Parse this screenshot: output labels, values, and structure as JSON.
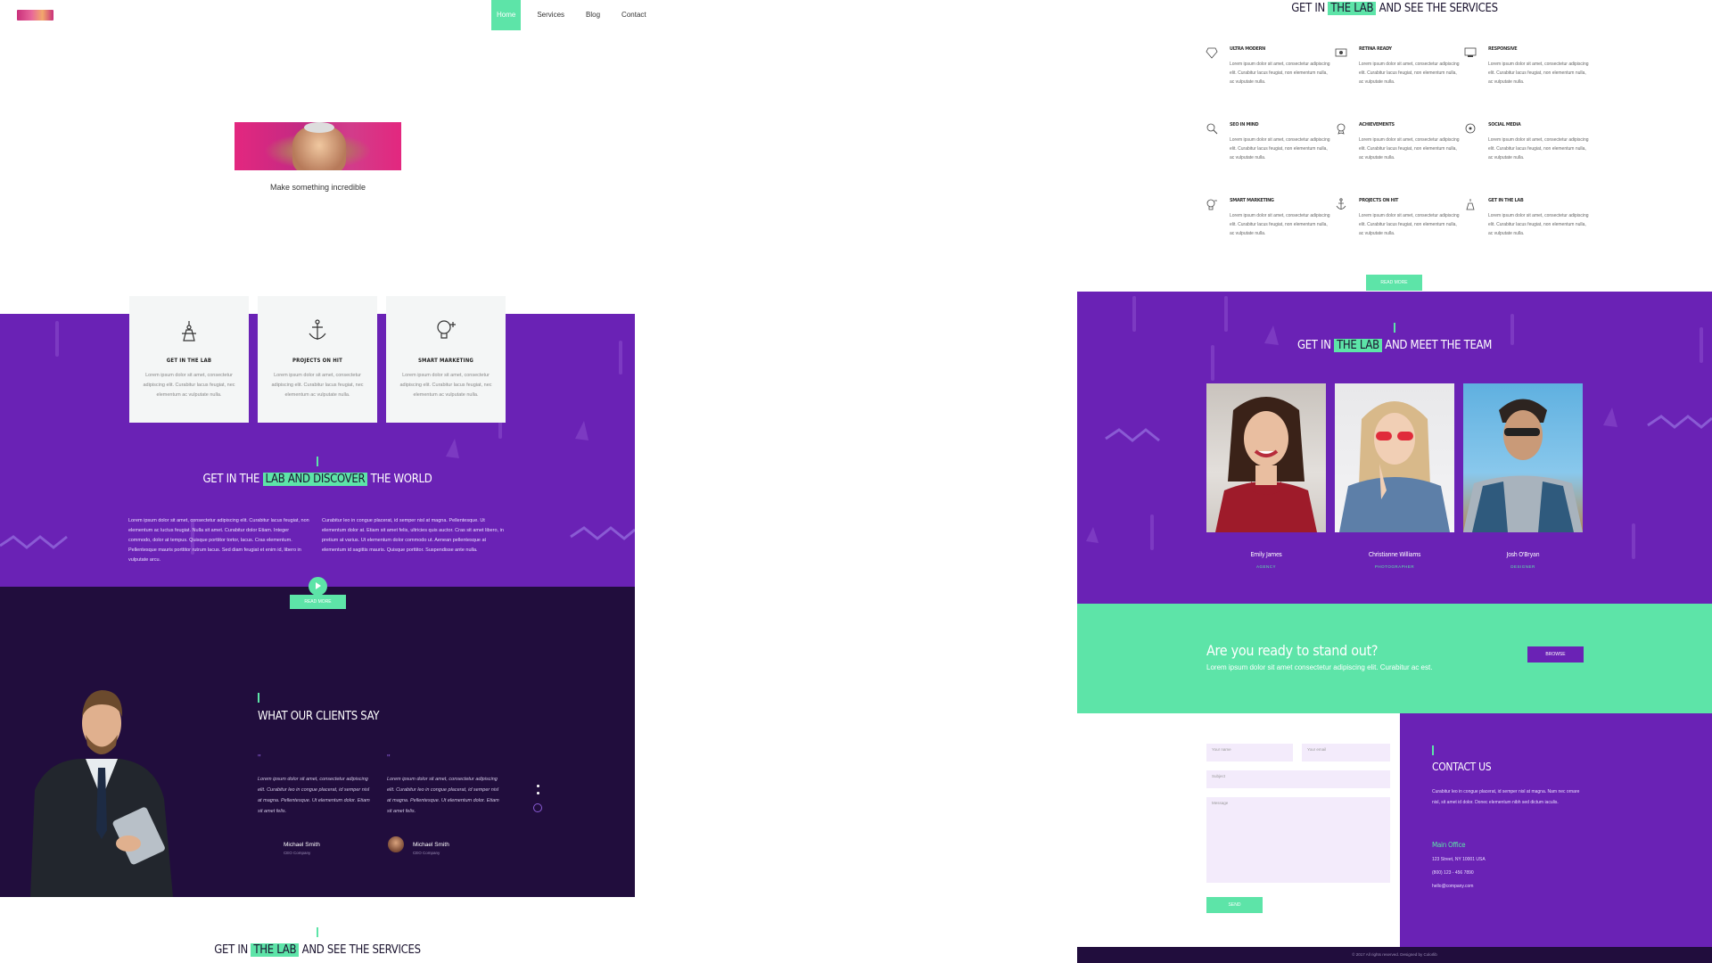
{
  "nav": {
    "items": [
      "Home",
      "Services",
      "Blog",
      "Contact"
    ],
    "active": "Home"
  },
  "hero": {
    "caption": "Make something incredible"
  },
  "features": [
    {
      "icon": "lab-icon",
      "title": "GET IN THE LAB",
      "text": "Lorem ipsum dolor sit amet, consectetur adipiscing elit. Curabitur lacus feugiat, nec elementum ac vulputate nulla."
    },
    {
      "icon": "anchor-icon",
      "title": "PROJECTS ON HIT",
      "text": "Lorem ipsum dolor sit amet, consectetur adipiscing elit. Curabitur lacus feugiat, nec elementum ac vulputate nulla."
    },
    {
      "icon": "lightbulb-gear-icon",
      "title": "SMART MARKETING",
      "text": "Lorem ipsum dolor sit amet, consectetur adipiscing elit. Curabitur lacus feugiat, nec elementum ac vulputate nulla."
    }
  ],
  "discover": {
    "title_pre": "GET IN THE ",
    "title_hl": "LAB AND DISCOVER",
    "title_post": " THE WORLD",
    "col1": "Lorem ipsum dolor sit amet, consectetur adipiscing elit. Curabitur lacus feugiat, non elementum ac luctus feugiat. Nulla sit amet. Curabitur dolor Etiam. Integer commodo, dolor at tempus. Quisque porttitor tortor, lacus. Cras elementum. Pellentesque mauris porttitor rutrum lacus. Sed diam feugiat et enim id, libero in vulputate arcu.",
    "col2": "Curabitur leo in congue placerat, id semper nisl at magna. Pellentesque. Ut elementum dolor at. Etiam sit amet felis, ultricies quis auctor. Cras sit amet libero, in pretium at varius. Ut elementum dolor commodo ut. Aenean pellentesque at elementum id sagittis mauris. Quisque porttitor. Suspendisse ante nulla.",
    "button": "READ MORE"
  },
  "clients": {
    "title": "WHAT OUR CLIENTS SAY",
    "quote1": "Lorem ipsum dolor sit amet, consectetur adipiscing elit. Curabitur leo in congue placerat, id semper nisl at magna. Pellentesque. Ut elementum dolor. Etiam sit amet felis.",
    "quote2": "Lorem ipsum dolor sit amet, consectetur adipiscing elit. Curabitur leo in congue placerat, id semper nisl at magna. Pellentesque. Ut elementum dolor. Etiam sit amet felis.",
    "name1": "Michael Smith",
    "role1": "CEO Company",
    "name2": "Michael Smith",
    "role2": "CEO Company"
  },
  "services_left": {
    "title_pre": "GET IN ",
    "title_hl": "THE LAB",
    "title_post": " AND SEE THE SERVICES"
  },
  "services": {
    "title_pre": "GET IN ",
    "title_hl": "THE LAB",
    "title_post": " AND SEE THE SERVICES",
    "items": [
      {
        "icon": "gem-icon",
        "title": "ULTRA MODERN",
        "text": "Lorem ipsum dolor sit amet, consectetur adipiscing elit. Curabitur lacus feugiat, non elementum nulla, ac vulputate nulla."
      },
      {
        "icon": "retina-icon",
        "title": "RETINA READY",
        "text": "Lorem ipsum dolor sit amet, consectetur adipiscing elit. Curabitur lacus feugiat, non elementum nulla, ac vulputate nulla."
      },
      {
        "icon": "responsive-icon",
        "title": "RESPONSIVE",
        "text": "Lorem ipsum dolor sit amet, consectetur adipiscing elit. Curabitur lacus feugiat, non elementum nulla, ac vulputate nulla."
      },
      {
        "icon": "magnifier-icon",
        "title": "SEO IN MIND",
        "text": "Lorem ipsum dolor sit amet, consectetur adipiscing elit. Curabitur lacus feugiat, non elementum nulla, ac vulputate nulla."
      },
      {
        "icon": "achievement-icon",
        "title": "ACHIEVEMENTS",
        "text": "Lorem ipsum dolor sit amet, consectetur adipiscing elit. Curabitur lacus feugiat, non elementum nulla, ac vulputate nulla."
      },
      {
        "icon": "social-icon",
        "title": "SOCIAL MEDIA",
        "text": "Lorem ipsum dolor sit amet, consectetur adipiscing elit. Curabitur lacus feugiat, non elementum nulla, ac vulputate nulla."
      },
      {
        "icon": "lightbulb-gear-icon",
        "title": "SMART MARKETING",
        "text": "Lorem ipsum dolor sit amet, consectetur adipiscing elit. Curabitur lacus feugiat, non elementum nulla, ac vulputate nulla."
      },
      {
        "icon": "anchor-icon",
        "title": "PROJECTS ON HIT",
        "text": "Lorem ipsum dolor sit amet, consectetur adipiscing elit. Curabitur lacus feugiat, non elementum nulla, ac vulputate nulla."
      },
      {
        "icon": "lab-icon",
        "title": "GET IN THE LAB",
        "text": "Lorem ipsum dolor sit amet, consectetur adipiscing elit. Curabitur lacus feugiat, non elementum nulla, ac vulputate nulla."
      }
    ],
    "button": "READ MORE"
  },
  "team": {
    "title_pre": "GET IN ",
    "title_hl": "THE LAB",
    "title_post": " AND MEET THE TEAM",
    "members": [
      {
        "name": "Emily James",
        "role": "AGENCY"
      },
      {
        "name": "Christianne Williams",
        "role": "PHOTOGRAPHER"
      },
      {
        "name": "Josh O'Bryan",
        "role": "DESIGNER"
      }
    ]
  },
  "cta": {
    "title": "Are you ready to stand out?",
    "text": "Lorem ipsum dolor sit amet consectetur adipiscing elit. Curabitur ac est.",
    "button": "BROWSE"
  },
  "contact": {
    "name_placeholder": "Your name",
    "email_placeholder": "Your email",
    "subject_placeholder": "Subject",
    "message_placeholder": "Message",
    "send": "SEND",
    "title": "CONTACT US",
    "text": "Curabitur leo in congue placerat, id semper nisl at magna. Nam nec ornare nisl, sit amet id dolor. Donec elementum nibh sed dictum iaculis.",
    "office_title": "Main Office",
    "address": "123 Street, NY 10001 USA",
    "phone": "(800) 123 - 456 7890",
    "email": "hello@company.com"
  },
  "footer": {
    "text": "© 2017 All rights reserved. Designed by Colorlib"
  },
  "colors": {
    "accent": "#5de4a8",
    "purple": "#6a22b5",
    "dark": "#210d3d"
  }
}
